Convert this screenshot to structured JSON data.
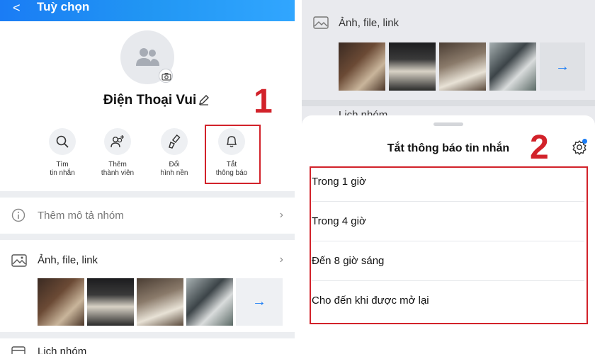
{
  "left": {
    "header": {
      "back_glyph": "<",
      "title": "Tuỳ chọn"
    },
    "group": {
      "name": "Điện Thoại Vui"
    },
    "step_number": "1",
    "actions": [
      {
        "line1": "Tìm",
        "line2": "tin nhắn",
        "icon": "search-icon"
      },
      {
        "line1": "Thêm",
        "line2": "thành viên",
        "icon": "add-member-icon"
      },
      {
        "line1": "Đổi",
        "line2": "hình nền",
        "icon": "paint-brush-icon"
      },
      {
        "line1": "Tắt",
        "line2": "thông báo",
        "icon": "bell-icon"
      }
    ],
    "rows": {
      "description": "Thêm mô tả nhóm",
      "media": "Ảnh, file, link",
      "calendar": "Lịch nhóm"
    }
  },
  "right": {
    "media_label": "Ảnh, file, link",
    "calendar_label": "Lịch nhóm",
    "step_number": "2",
    "sheet_title": "Tắt thông báo tin nhắn",
    "options": [
      "Trong 1 giờ",
      "Trong 4 giờ",
      "Đến 8 giờ sáng",
      "Cho đến khi được mở lại"
    ]
  },
  "colors": {
    "accent": "#1a7cf5",
    "highlight": "#d2222a"
  }
}
